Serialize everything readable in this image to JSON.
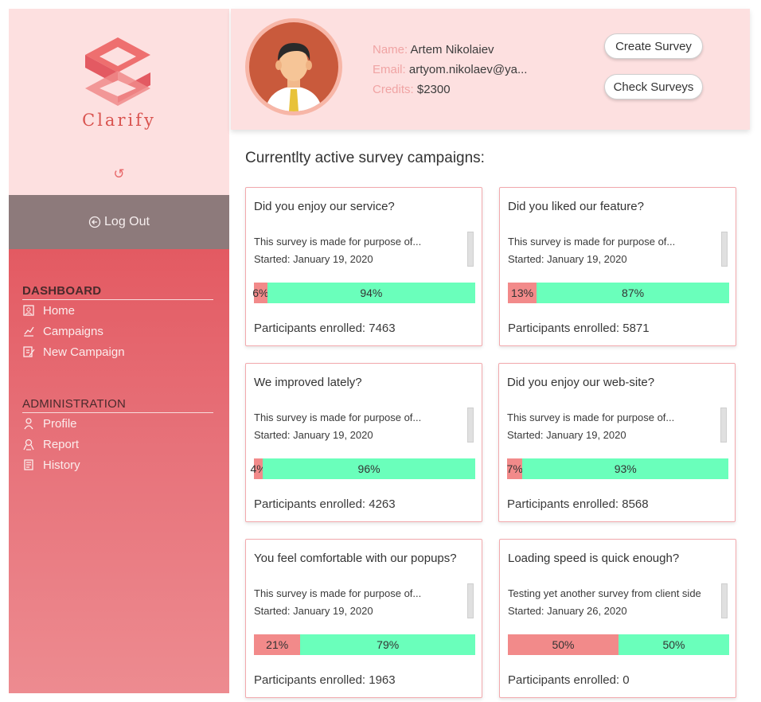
{
  "brand": {
    "name": "Clarify"
  },
  "sidebar": {
    "refresh_icon": "refresh-icon",
    "logout_label": "Log Out",
    "dashboard_heading": "DASHBOARD",
    "dashboard_items": [
      {
        "label": "Home",
        "icon": "home-icon"
      },
      {
        "label": "Campaigns",
        "icon": "chart-icon"
      },
      {
        "label": "New Campaign",
        "icon": "edit-icon"
      }
    ],
    "admin_heading": "ADMINISTRATION",
    "admin_items": [
      {
        "label": "Profile",
        "icon": "user-icon"
      },
      {
        "label": "Report",
        "icon": "report-icon"
      },
      {
        "label": "History",
        "icon": "history-icon"
      }
    ]
  },
  "profile": {
    "name_key": "Name:",
    "name": "Artem Nikolaiev",
    "email_key": "Email:",
    "email": "artyom.nikolaev@ya...",
    "credits_key": "Credits:",
    "credits": "$2300"
  },
  "header": {
    "create_label": "Create Survey",
    "check_label": "Check Surveys"
  },
  "main": {
    "title": "Currentlty active survey campaigns:",
    "participants_prefix": "Participants enrolled:",
    "cards": [
      {
        "title": "Did you enjoy our service?",
        "desc": "This survey is made for purpose of...",
        "started": "Started: January 19, 2020",
        "no_label": "6%",
        "yes_label": "94%",
        "no": 6,
        "participants": "Participants enrolled: 7463"
      },
      {
        "title": "Did you liked our feature?",
        "desc": "This survey is made for purpose of...",
        "started": "Started: January 19, 2020",
        "no_label": "13%",
        "yes_label": "87%",
        "no": 13,
        "participants": "Participants enrolled: 5871"
      },
      {
        "title": "We improved lately?",
        "desc": "This survey is made for purpose of...",
        "started": "Started: January 19, 2020",
        "no_label": "4%",
        "yes_label": "96%",
        "no": 4,
        "participants": "Participants enrolled: 4263"
      },
      {
        "title": "Did you enjoy our web-site?",
        "desc": "This survey is made for purpose of...",
        "started": "Started: January 19, 2020",
        "no_label": "7%",
        "yes_label": "93%",
        "no": 7,
        "participants": "Participants enrolled: 8568"
      },
      {
        "title": "You feel comfortable with our popups?",
        "desc": "This survey is made for purpose of...",
        "started": "Started: January 19, 2020",
        "no_label": "21%",
        "yes_label": "79%",
        "no": 21,
        "participants": "Participants enrolled: 1963"
      },
      {
        "title": "Loading speed is quick enough?",
        "desc": "Testing yet another survey from client side",
        "started": "Started: January 26, 2020",
        "no_label": "50%",
        "yes_label": "50%",
        "no": 50,
        "participants": "Participants enrolled: 0"
      }
    ]
  },
  "colors": {
    "accent": "#e35a62",
    "no": "#f28a8a",
    "yes": "#6affbb",
    "panel": "#fde0e0"
  }
}
